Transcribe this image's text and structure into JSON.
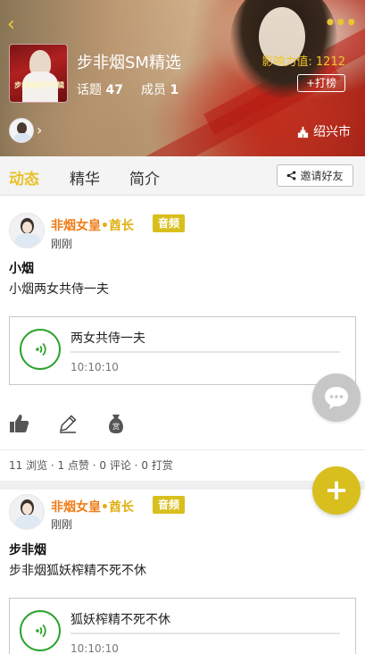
{
  "header": {
    "back_glyph": "‹",
    "more_glyph": "•••",
    "group_name": "步非烟SM精选",
    "cover_text": "步非烟有声专辑",
    "topics_label": "话题",
    "topics_count": "47",
    "members_label": "成员",
    "members_count": "1",
    "heat": "影响力值: 1212",
    "checkin_label": "+打榜",
    "avatar_arrow": "›",
    "city": "绍兴市",
    "accent_color": "#e8c12a"
  },
  "tabs": {
    "items": [
      "动态",
      "精华",
      "简介"
    ],
    "active": "动态",
    "invite_label": "邀请好友"
  },
  "posts": [
    {
      "author": "非烟女皇",
      "role": "•酋长",
      "badge": "音频",
      "time": "刚刚",
      "title": "小烟",
      "body": "小烟两女共侍一夫",
      "audio_name": "两女共侍一夫",
      "audio_time": "10:10:10",
      "stats": "11 浏览 · 1 点赞 · 0 评论 · 0 打赏",
      "actions": [
        "like-icon",
        "edit-icon",
        "reward-icon"
      ]
    },
    {
      "author": "非烟女皇",
      "role": "•酋长",
      "badge": "音频",
      "time": "刚刚",
      "title": "步非烟",
      "body": "步非烟狐妖榨精不死不休",
      "audio_name": "狐妖榨精不死不休",
      "audio_time": "10:10:10"
    }
  ],
  "fab": {
    "add_glyph": "+",
    "chat_icon": "chat-bubble-icon",
    "add_color": "#d8bf1e"
  }
}
